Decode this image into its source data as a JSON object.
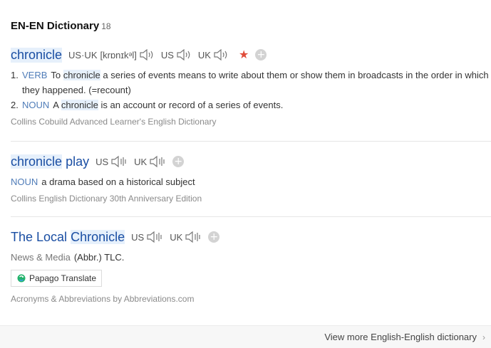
{
  "header": {
    "title": "EN-EN Dictionary",
    "count": "18"
  },
  "entry1": {
    "headword": "chronicle",
    "pron_label": "US·UK",
    "pron_ipa": "[krɒnɪkᵊl]",
    "us_label": "US",
    "uk_label": "UK",
    "senses": [
      {
        "num": "1.",
        "pos": "VERB",
        "pre": "To",
        "kw": "chronicle",
        "post": "a series of events means to write about them or show them in broadcasts in the order in which they happened. (=recount)"
      },
      {
        "num": "2.",
        "pos": "NOUN",
        "pre": "A",
        "kw": "chronicle",
        "post": "is an account or record of a series of events."
      }
    ],
    "source": "Collins Cobuild Advanced Learner's English Dictionary"
  },
  "entry2": {
    "headword_hl": "chronicle",
    "headword_rest": "play",
    "us_label": "US",
    "uk_label": "UK",
    "pos": "NOUN",
    "definition": "a drama based on a historical subject",
    "source": "Collins English Dictionary 30th Anniversary Edition"
  },
  "entry3": {
    "headword_pre": "The Local",
    "headword_hl": "Chronicle",
    "us_label": "US",
    "uk_label": "UK",
    "category": "News & Media",
    "definition": "(Abbr.) TLC.",
    "papago_label": "Papago Translate",
    "source": "Acronyms & Abbreviations by Abbreviations.com"
  },
  "footer": {
    "more_label": "View more English-English dictionary"
  },
  "colors": {
    "headword": "#1a4ea3",
    "pos": "#4f7cb8",
    "highlight": "#e6f0fb",
    "star": "#e04c3a"
  }
}
